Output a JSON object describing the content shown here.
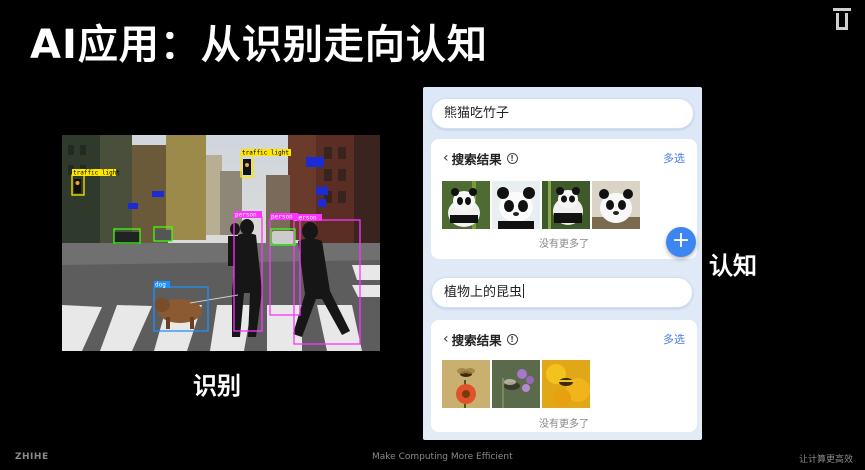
{
  "slide": {
    "title": "AI应用：从识别走向认知",
    "caption_left": "识别",
    "caption_right": "认知"
  },
  "detections": [
    {
      "label": "traffic light",
      "color": "#ffe600"
    },
    {
      "label": "traffic light",
      "color": "#ffe600"
    },
    {
      "label": "dog",
      "color": "#1e90ff"
    },
    {
      "label": "person",
      "color": "#ff33ff"
    },
    {
      "label": "person",
      "color": "#ff33ff"
    },
    {
      "label": "person",
      "color": "#ff33ff"
    }
  ],
  "phone": {
    "query1": "熊猫吃竹子",
    "query2": "植物上的昆虫",
    "results_label": "搜索结果",
    "info_symbol": "!",
    "multi_select": "多选",
    "no_more": "没有更多了",
    "fab_symbol": "+",
    "results1": [
      "panda-photo-1",
      "panda-photo-2",
      "panda-photo-3",
      "panda-photo-4"
    ],
    "results2": [
      "insect-photo-1",
      "insect-photo-2",
      "insect-photo-3"
    ]
  },
  "footer": {
    "left": "ZHIHE",
    "middle": "Make Computing More Efficient",
    "right": "让计算更高效"
  },
  "colors": {
    "background": "#000000",
    "accent": "#3d86f2",
    "box_person": "#ff33ff",
    "box_dog": "#1e90ff",
    "box_light": "#ffe600"
  }
}
